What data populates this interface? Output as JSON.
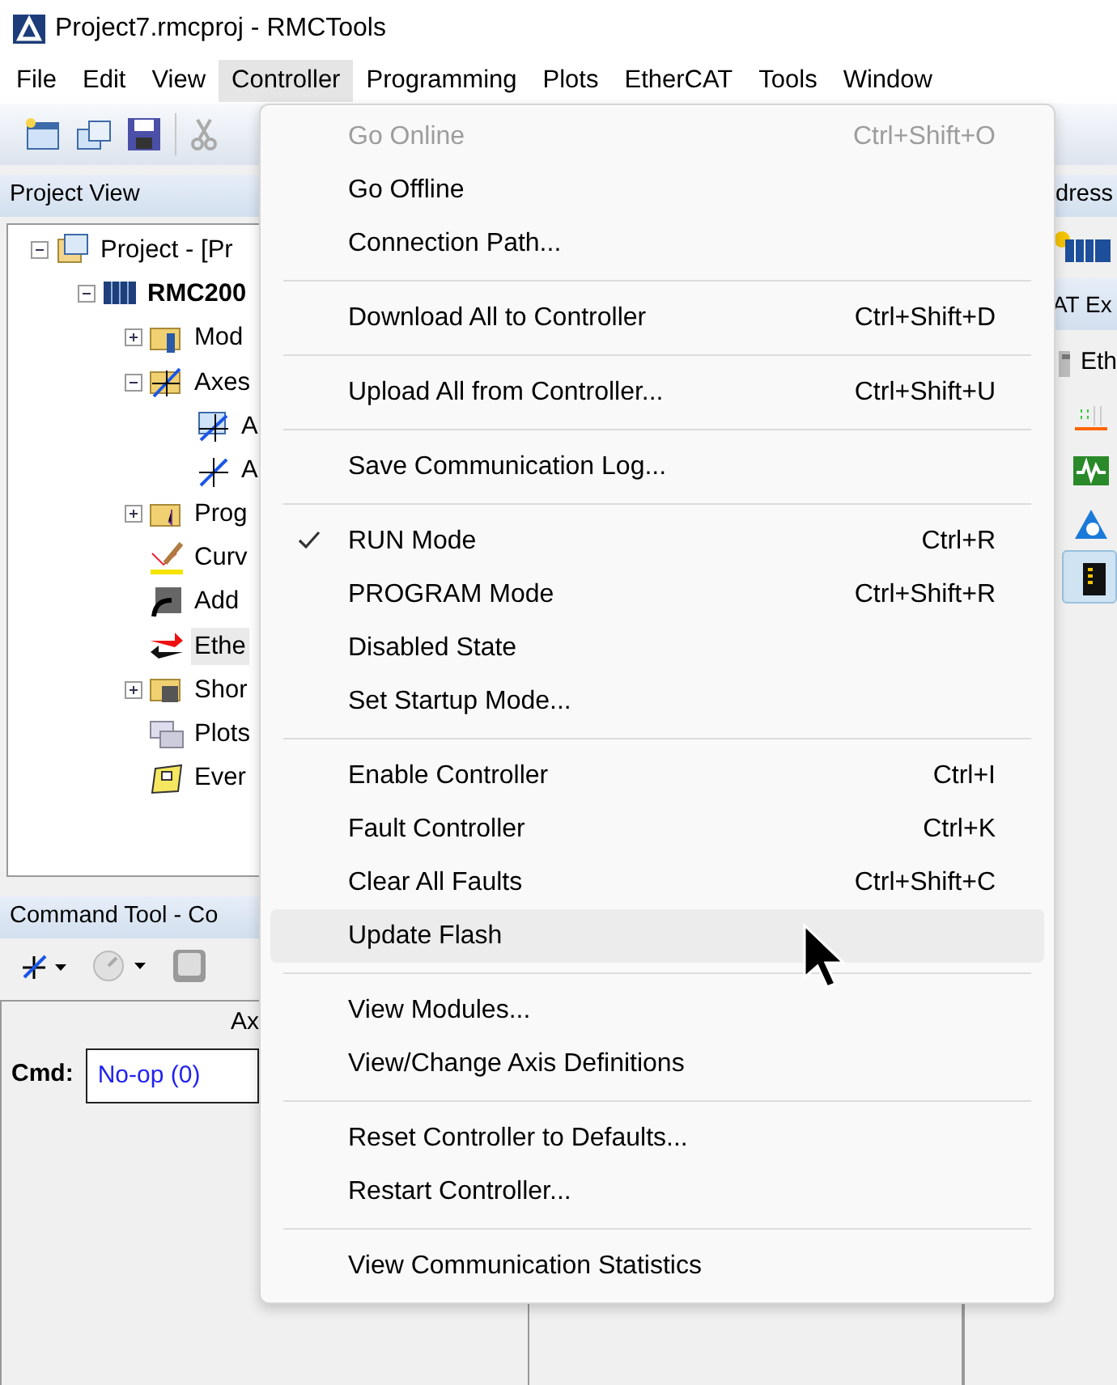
{
  "window": {
    "title": "Project7.rmcproj - RMCTools"
  },
  "menubar": [
    {
      "label": "File",
      "selected": false
    },
    {
      "label": "Edit",
      "selected": false
    },
    {
      "label": "View",
      "selected": false
    },
    {
      "label": "Controller",
      "selected": true
    },
    {
      "label": "Programming",
      "selected": false
    },
    {
      "label": "Plots",
      "selected": false
    },
    {
      "label": "EtherCAT",
      "selected": false
    },
    {
      "label": "Tools",
      "selected": false
    },
    {
      "label": "Window",
      "selected": false
    }
  ],
  "project_view": {
    "title": "Project View",
    "tree": [
      {
        "label": "Project - [Pr",
        "bold": false,
        "expanded": true,
        "selected": false,
        "children": [
          {
            "label": "RMC200",
            "bold": true,
            "expanded": true,
            "selected": false,
            "children": [
              {
                "label": "Mod",
                "bold": false,
                "expanded": false,
                "selected": false
              },
              {
                "label": "Axes",
                "bold": false,
                "expanded": true,
                "selected": false,
                "children": [
                  {
                    "label": "A",
                    "bold": false,
                    "selected": false
                  },
                  {
                    "label": "A",
                    "bold": false,
                    "selected": false
                  }
                ]
              },
              {
                "label": "Prog",
                "bold": false,
                "expanded": false,
                "selected": false
              },
              {
                "label": "Curv",
                "bold": false,
                "selected": false
              },
              {
                "label": "Add",
                "bold": false,
                "selected": false
              },
              {
                "label": "Ethe",
                "bold": false,
                "selected": true
              },
              {
                "label": "Shor",
                "bold": false,
                "expanded": false,
                "selected": false
              },
              {
                "label": "Plots",
                "bold": false,
                "selected": false
              },
              {
                "label": "Ever",
                "bold": false,
                "selected": false
              }
            ]
          }
        ]
      }
    ]
  },
  "command_tool": {
    "title": "Command Tool - Co",
    "column_1": "Ax",
    "cmd_label": "Cmd:",
    "cmd_value": "No-op (0)"
  },
  "right_panel": {
    "title": "dress",
    "section": "AT Ex",
    "items": [
      {
        "label": "Eth",
        "selected": false
      },
      {
        "selected": false
      },
      {
        "selected": false
      },
      {
        "selected": false
      },
      {
        "selected": true
      }
    ]
  },
  "controller_menu": [
    {
      "kind": "item",
      "label": "Go Online",
      "shortcut": "Ctrl+Shift+O",
      "disabled": true,
      "checked": false,
      "hovered": false
    },
    {
      "kind": "item",
      "label": "Go Offline",
      "disabled": false,
      "checked": false,
      "hovered": false
    },
    {
      "kind": "item",
      "label": "Connection Path...",
      "disabled": false,
      "checked": false,
      "hovered": false
    },
    {
      "kind": "separator"
    },
    {
      "kind": "item",
      "label": "Download All to Controller",
      "shortcut": "Ctrl+Shift+D",
      "disabled": false,
      "checked": false,
      "hovered": false
    },
    {
      "kind": "separator"
    },
    {
      "kind": "item",
      "label": "Upload All from Controller...",
      "shortcut": "Ctrl+Shift+U",
      "disabled": false,
      "checked": false,
      "hovered": false
    },
    {
      "kind": "separator"
    },
    {
      "kind": "item",
      "label": "Save Communication Log...",
      "disabled": false,
      "checked": false,
      "hovered": false
    },
    {
      "kind": "separator"
    },
    {
      "kind": "item",
      "label": "RUN Mode",
      "shortcut": "Ctrl+R",
      "disabled": false,
      "checked": true,
      "hovered": false
    },
    {
      "kind": "item",
      "label": "PROGRAM Mode",
      "shortcut": "Ctrl+Shift+R",
      "disabled": false,
      "checked": false,
      "hovered": false
    },
    {
      "kind": "item",
      "label": "Disabled State",
      "disabled": false,
      "checked": false,
      "hovered": false
    },
    {
      "kind": "item",
      "label": "Set Startup Mode...",
      "disabled": false,
      "checked": false,
      "hovered": false
    },
    {
      "kind": "separator"
    },
    {
      "kind": "item",
      "label": "Enable Controller",
      "shortcut": "Ctrl+I",
      "disabled": false,
      "checked": false,
      "hovered": false
    },
    {
      "kind": "item",
      "label": "Fault Controller",
      "shortcut": "Ctrl+K",
      "disabled": false,
      "checked": false,
      "hovered": false
    },
    {
      "kind": "item",
      "label": "Clear All Faults",
      "shortcut": "Ctrl+Shift+C",
      "disabled": false,
      "checked": false,
      "hovered": false
    },
    {
      "kind": "item",
      "label": "Update Flash",
      "disabled": false,
      "checked": false,
      "hovered": true
    },
    {
      "kind": "separator"
    },
    {
      "kind": "item",
      "label": "View Modules...",
      "disabled": false,
      "checked": false,
      "hovered": false
    },
    {
      "kind": "item",
      "label": "View/Change Axis Definitions",
      "disabled": false,
      "checked": false,
      "hovered": false
    },
    {
      "kind": "separator"
    },
    {
      "kind": "item",
      "label": "Reset Controller to Defaults...",
      "disabled": false,
      "checked": false,
      "hovered": false
    },
    {
      "kind": "item",
      "label": "Restart Controller...",
      "disabled": false,
      "checked": false,
      "hovered": false
    },
    {
      "kind": "separator"
    },
    {
      "kind": "item",
      "label": "View Communication Statistics",
      "disabled": false,
      "checked": false,
      "hovered": false
    }
  ]
}
